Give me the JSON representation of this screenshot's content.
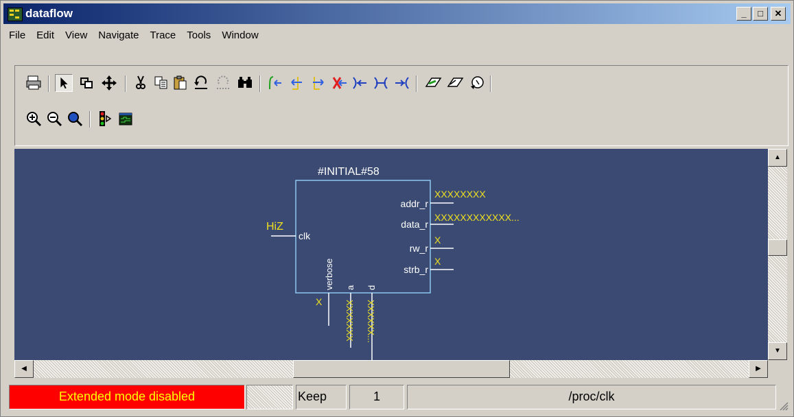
{
  "window": {
    "title": "dataflow",
    "controls": [
      "minimize",
      "maximize",
      "close"
    ]
  },
  "menu": [
    "File",
    "Edit",
    "View",
    "Navigate",
    "Trace",
    "Tools",
    "Window"
  ],
  "toolbar": {
    "row1": [
      "print-icon",
      "select-pointer-icon",
      "zoom-area-icon",
      "pan-icon",
      "cut-icon",
      "copy-icon",
      "paste-icon",
      "undo-icon",
      "redo-icon",
      "find-icon",
      "trace-input-icon",
      "trace-back-icon",
      "trace-forward-icon",
      "trace-x-icon",
      "expand-left-icon",
      "expand-both-icon",
      "expand-right-icon",
      "erase-1-icon",
      "erase-2-icon",
      "erase-3-icon"
    ],
    "row2": [
      "zoom-in-icon",
      "zoom-out-icon",
      "zoom-full-icon",
      "stop-light-icon",
      "wave-window-icon"
    ]
  },
  "diagram": {
    "block_name": "#INITIAL#58",
    "left_port": {
      "name": "clk",
      "value": "HiZ"
    },
    "right_ports": [
      {
        "name": "addr_r",
        "value": "XXXXXXXX"
      },
      {
        "name": "data_r",
        "value": "XXXXXXXXXXXX..."
      },
      {
        "name": "rw_r",
        "value": "X"
      },
      {
        "name": "strb_r",
        "value": "X"
      }
    ],
    "bottom_ports": [
      {
        "name": "verbose",
        "value": "X"
      },
      {
        "name": "a",
        "value": "XXXXXXX"
      },
      {
        "name": "d",
        "value": "XXXXXX..."
      }
    ]
  },
  "status": {
    "mode": "Extended mode disabled",
    "empty": "",
    "keep_label": "Keep",
    "keep_value": "1",
    "path": "/proc/clk"
  },
  "colors": {
    "canvas": "#3a4a72",
    "signal_value": "#f0e020",
    "block_border": "#8ec8f0",
    "status_alert": "#ff0000"
  }
}
